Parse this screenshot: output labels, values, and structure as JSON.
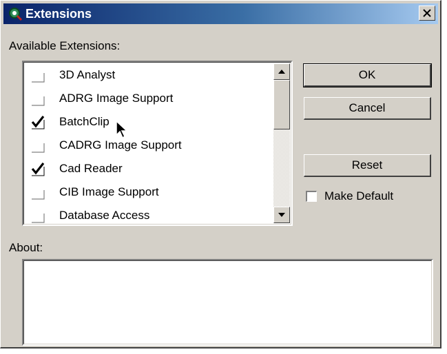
{
  "window": {
    "title": "Extensions"
  },
  "labels": {
    "available": "Available Extensions:",
    "about": "About:"
  },
  "extensions": [
    {
      "label": "3D Analyst",
      "checked": false
    },
    {
      "label": "ADRG Image Support",
      "checked": false
    },
    {
      "label": "BatchClip",
      "checked": true
    },
    {
      "label": "CADRG Image Support",
      "checked": false
    },
    {
      "label": "Cad Reader",
      "checked": true
    },
    {
      "label": "CIB Image Support",
      "checked": false
    },
    {
      "label": "Database Access",
      "checked": false
    }
  ],
  "buttons": {
    "ok": "OK",
    "cancel": "Cancel",
    "reset": "Reset"
  },
  "make_default": {
    "label": "Make Default",
    "checked": false
  },
  "about_text": "",
  "icons": [
    "app-icon",
    "close-icon",
    "checkmark-icon",
    "scroll-up-icon",
    "scroll-down-icon",
    "mouse-pointer-icon"
  ]
}
